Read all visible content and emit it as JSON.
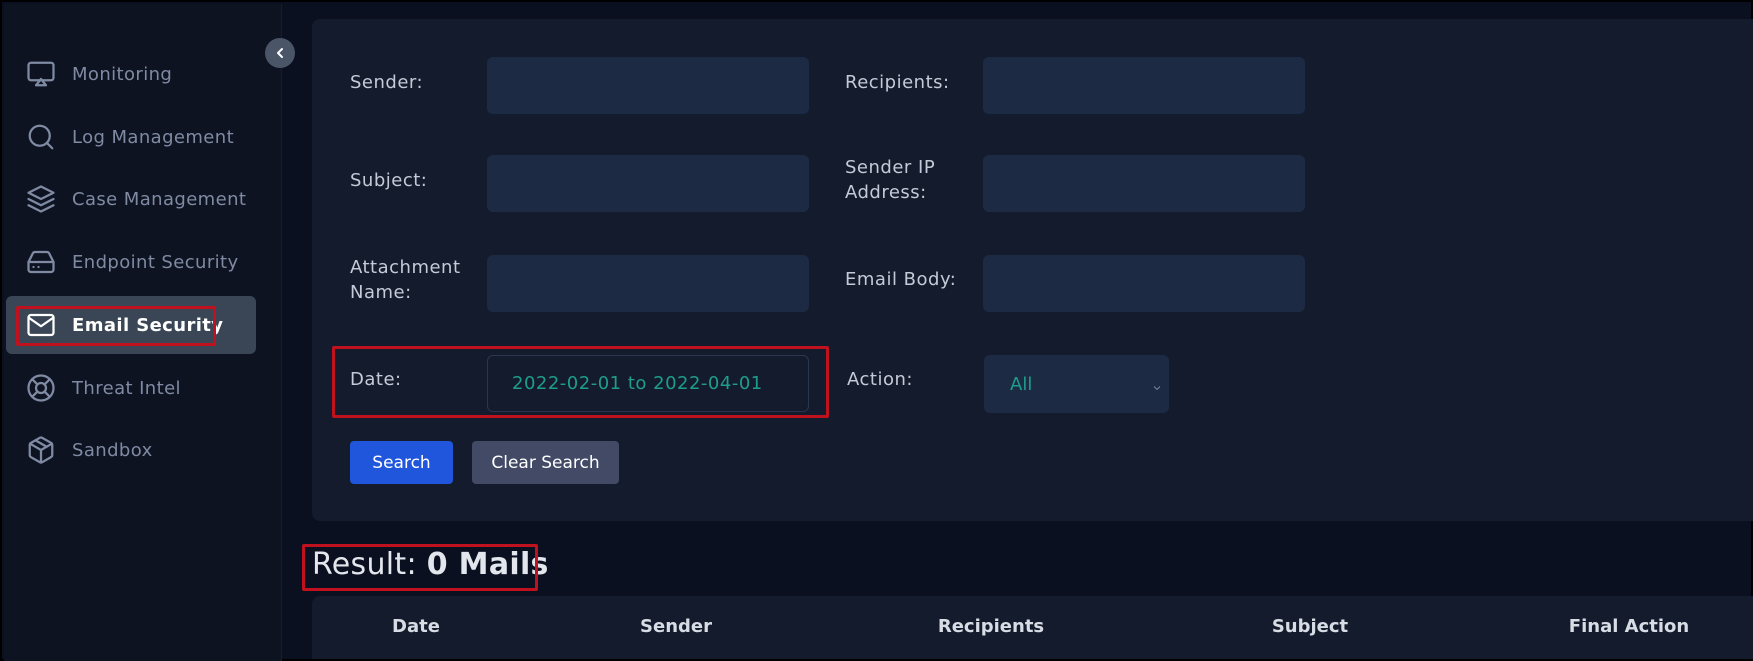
{
  "sidebar": {
    "items": [
      {
        "label": "Monitoring",
        "icon": "monitor-icon"
      },
      {
        "label": "Log Management",
        "icon": "search-icon"
      },
      {
        "label": "Case Management",
        "icon": "layers-icon"
      },
      {
        "label": "Endpoint Security",
        "icon": "hard-drive-icon"
      },
      {
        "label": "Email Security",
        "icon": "mail-icon",
        "active": true
      },
      {
        "label": "Threat Intel",
        "icon": "life-buoy-icon"
      },
      {
        "label": "Sandbox",
        "icon": "package-icon"
      }
    ]
  },
  "search": {
    "sender_label": "Sender:",
    "sender_value": "",
    "recipients_label": "Recipients:",
    "recipients_value": "",
    "subject_label": "Subject:",
    "subject_value": "",
    "sender_ip_label_line1": "Sender IP",
    "sender_ip_label_line2": "Address:",
    "sender_ip_value": "",
    "attachment_label_line1": "Attachment",
    "attachment_label_line2": "Name:",
    "attachment_value": "",
    "email_body_label": "Email Body:",
    "email_body_value": "",
    "date_label": "Date:",
    "date_value": "2022-02-01 to 2022-04-01",
    "action_label": "Action:",
    "action_selected": "All",
    "search_button": "Search",
    "clear_button": "Clear Search"
  },
  "result": {
    "prefix": "Result: ",
    "count_text": "0 Mails"
  },
  "table": {
    "columns": [
      "Date",
      "Sender",
      "Recipients",
      "Subject",
      "Final Action"
    ]
  },
  "colors": {
    "highlight": "#c0121e",
    "primary_button": "#2056dc",
    "accent_text": "#1f9d8c"
  }
}
